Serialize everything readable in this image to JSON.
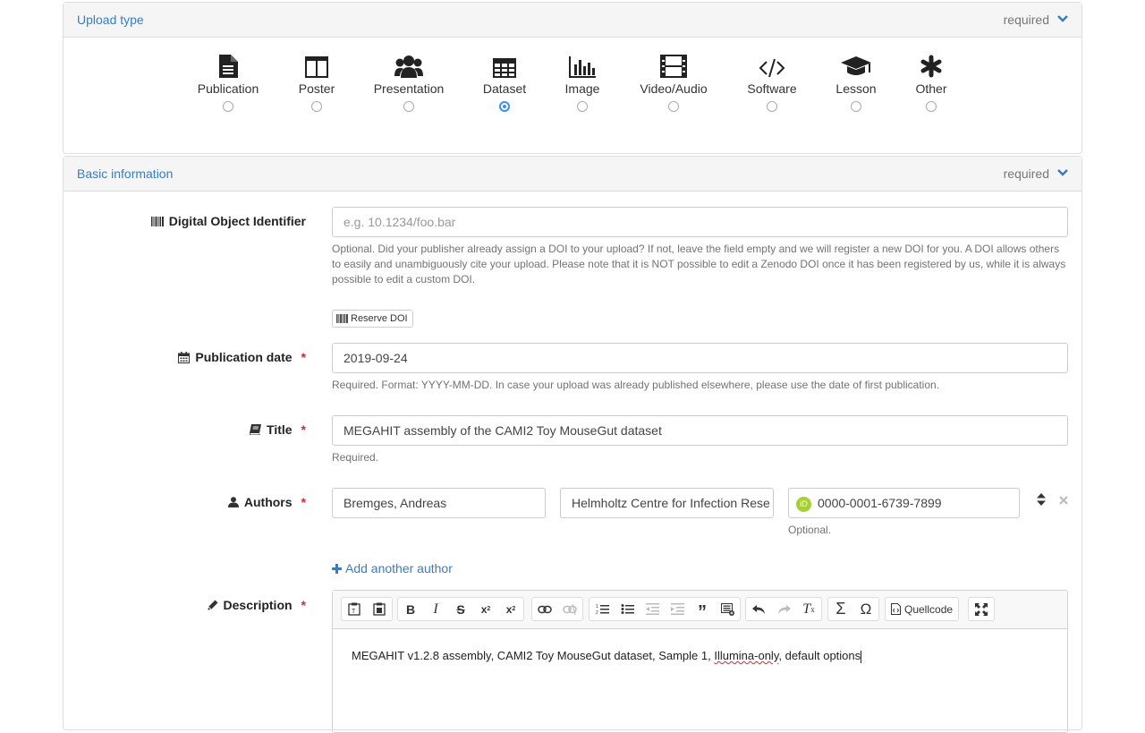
{
  "upload_type": {
    "title": "Upload type",
    "required": "required",
    "types": [
      {
        "label": "Publication",
        "icon": "file-text-icon",
        "selected": false
      },
      {
        "label": "Poster",
        "icon": "columns-icon",
        "selected": false
      },
      {
        "label": "Presentation",
        "icon": "group-icon",
        "selected": false
      },
      {
        "label": "Dataset",
        "icon": "table-icon",
        "selected": true
      },
      {
        "label": "Image",
        "icon": "bar-chart-icon",
        "selected": false
      },
      {
        "label": "Video/Audio",
        "icon": "film-icon",
        "selected": false
      },
      {
        "label": "Software",
        "icon": "code-icon",
        "selected": false
      },
      {
        "label": "Lesson",
        "icon": "graduation-cap-icon",
        "selected": false
      },
      {
        "label": "Other",
        "icon": "asterisk-icon",
        "selected": false
      }
    ]
  },
  "basic_info": {
    "title": "Basic information",
    "required": "required",
    "doi": {
      "label": "Digital Object Identifier",
      "placeholder": "e.g. 10.1234/foo.bar",
      "help": "Optional. Did your publisher already assign a DOI to your upload? If not, leave the field empty and we will register a new DOI for you. A DOI allows others to easily and unambiguously cite your upload. Please note that it is NOT possible to edit a Zenodo DOI once it has been registered by us, while it is always possible to edit a custom DOI.",
      "reserve_button": "Reserve DOI"
    },
    "publication_date": {
      "label": "Publication date",
      "value": "2019-09-24",
      "help": "Required. Format: YYYY-MM-DD. In case your upload was already published elsewhere, please use the date of first publication."
    },
    "title_field": {
      "label": "Title",
      "value": "MEGAHIT assembly of the CAMI2 Toy MouseGut dataset",
      "help": "Required."
    },
    "authors": {
      "label": "Authors",
      "name": "Bremges, Andreas",
      "affiliation": "Helmholtz Centre for Infection Rese",
      "orcid": "0000-0001-6739-7899",
      "orcid_help": "Optional.",
      "add_another": "Add another author"
    },
    "description": {
      "label": "Description",
      "source_button": "Quellcode",
      "text_before": "MEGAHIT v1.2.8 assembly, CAMI2 Toy MouseGut dataset, Sample 1, ",
      "text_misspelled": "Illumina-only",
      "text_after": ", default options"
    },
    "star": "*"
  },
  "colors": {
    "accent": "#3a7cc0",
    "required_star": "#d9262c",
    "radio_selected": "#3a8ef6",
    "orcid": "#a6ce39"
  }
}
